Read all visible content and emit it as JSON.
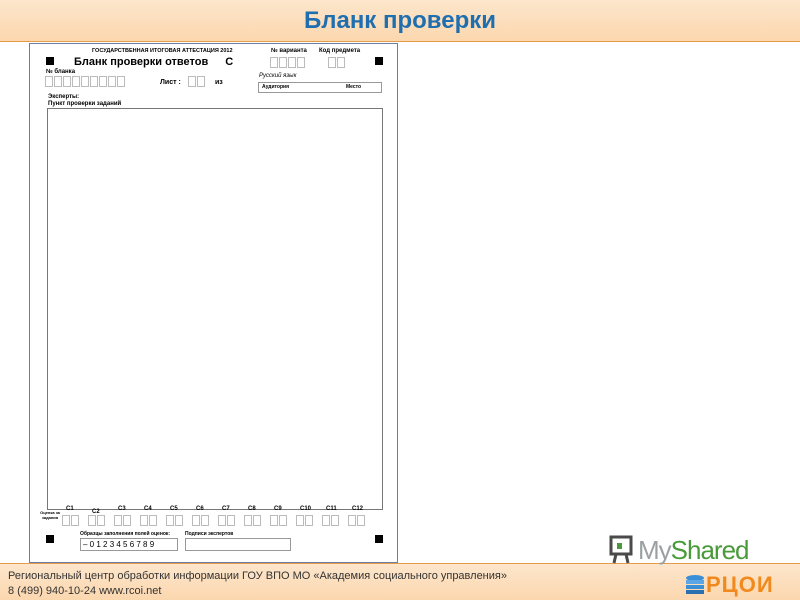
{
  "slide": {
    "title": "Бланк проверки"
  },
  "form": {
    "gia_header": "ГОСУДАРСТВЕННАЯ ИТОГОВАЯ АТТЕСТАЦИЯ 2012",
    "title": "Бланк проверки ответов",
    "title_letter": "С",
    "variant_label": "№ варианта",
    "subject_code_label": "Код предмета",
    "blank_number_label": "№ бланка",
    "sheet_label": "Лист :",
    "of_label": "из",
    "subject_name": "Русский язык",
    "auditorium_label": "Аудитория",
    "place_label": "Место",
    "experts_label": "Эксперты:",
    "check_point_label": "Пункт проверки заданий",
    "score_label": "Оценка за задания",
    "tasks": [
      "С1",
      "С2",
      "С3",
      "С4",
      "С5",
      "С6",
      "С7",
      "С8",
      "С9",
      "С10",
      "С11",
      "С12"
    ],
    "sample_label": "Образцы заполнения полей оценок:",
    "sample_digits": "– 0 1 2 3 4 5 6 7 8 9",
    "signature_label": "Подписи экспертов"
  },
  "footer": {
    "organization": "Региональный центр обработки информации ГОУ ВПО МО «Академия социального управления»",
    "contact": "8 (499) 940-10-24 www.rcoi.net"
  },
  "logos": {
    "myshared_my": "My",
    "myshared_shared": "Shared",
    "rcoi": "РЦОИ"
  }
}
